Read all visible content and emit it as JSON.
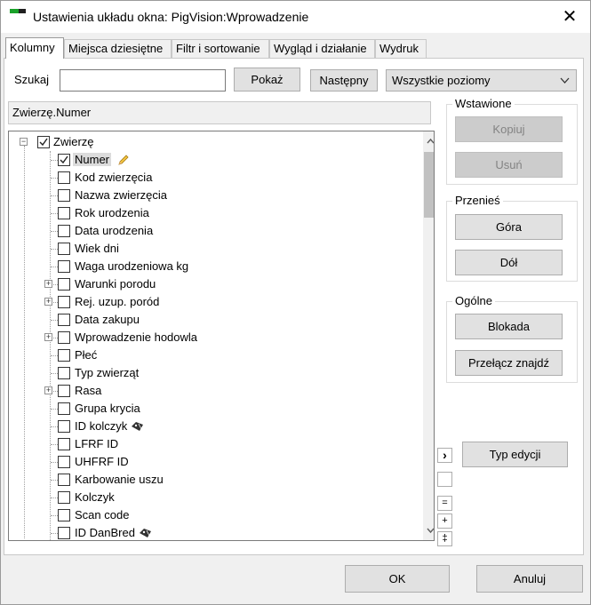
{
  "window": {
    "title": "Ustawienia układu okna: PigVision:Wprowadzenie",
    "close_glyph": "✕"
  },
  "tabs": [
    {
      "label": "Kolumny",
      "active": true
    },
    {
      "label": "Miejsca dziesiętne"
    },
    {
      "label": "Filtr i sortowanie"
    },
    {
      "label": "Wygląd i działanie"
    },
    {
      "label": "Wydruk"
    }
  ],
  "search": {
    "label": "Szukaj",
    "value": "",
    "show_label": "Pokaż",
    "next_label": "Następny",
    "level_selected": "Wszystkie poziomy"
  },
  "path_field": "Zwierzę.Numer",
  "tree": {
    "root": {
      "label": "Zwierzę",
      "checked": true,
      "expanded": true
    },
    "items": [
      {
        "label": "Numer",
        "checked": true,
        "selected": true,
        "icon": "pencil-icon"
      },
      {
        "label": "Kod zwierzęcia"
      },
      {
        "label": "Nazwa zwierzęcia"
      },
      {
        "label": "Rok urodzenia"
      },
      {
        "label": "Data urodzenia"
      },
      {
        "label": "Wiek dni"
      },
      {
        "label": "Waga urodzeniowa kg"
      },
      {
        "label": "Warunki porodu",
        "expandable": true
      },
      {
        "label": "Rej. uzup. poród",
        "expandable": true
      },
      {
        "label": "Data zakupu"
      },
      {
        "label": "Wprowadzenie hodowla",
        "expandable": true
      },
      {
        "label": "Płeć"
      },
      {
        "label": "Typ zwierząt"
      },
      {
        "label": "Rasa",
        "expandable": true
      },
      {
        "label": "Grupa krycia"
      },
      {
        "label": "ID kolczyk",
        "icon": "tag-icon"
      },
      {
        "label": "LFRF ID"
      },
      {
        "label": "UHFRF ID"
      },
      {
        "label": "Karbowanie uszu"
      },
      {
        "label": "Kolczyk"
      },
      {
        "label": "Scan code"
      },
      {
        "label": "ID DanBred",
        "icon": "tag-icon"
      }
    ]
  },
  "groups": {
    "inserted": {
      "title": "Wstawione",
      "copy_label": "Kopiuj",
      "delete_label": "Usuń"
    },
    "move": {
      "title": "Przenieś",
      "up_label": "Góra",
      "down_label": "Dół"
    },
    "general": {
      "title": "Ogólne",
      "lock_label": "Blokada",
      "toggle_find_label": "Przełącz znajdź"
    }
  },
  "edit_type_label": "Typ edycji",
  "side_buttons": {
    "expand_glyph": "›",
    "equal_glyph": "=",
    "plus_glyph": "+",
    "plusplus_glyph": "‡"
  },
  "footer": {
    "ok_label": "OK",
    "cancel_label": "Anuluj"
  },
  "colors": {
    "accent_green": "#1aa12a"
  }
}
